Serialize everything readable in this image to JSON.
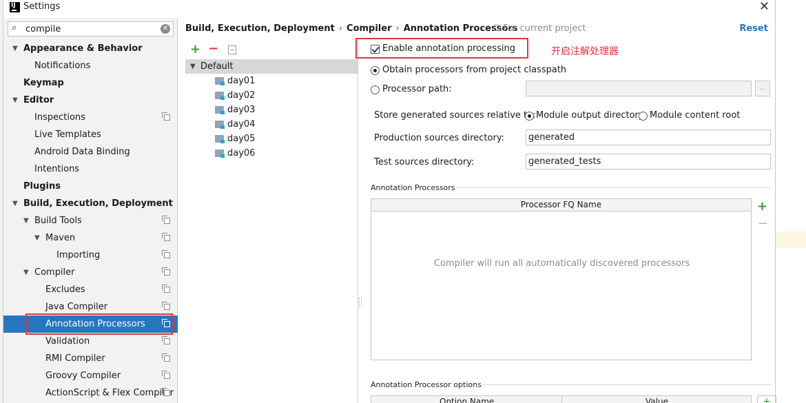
{
  "window": {
    "title": "Settings"
  },
  "search": {
    "value": "compile"
  },
  "sidebar": {
    "items": [
      {
        "label": "Appearance & Behavior",
        "level": 0,
        "arrow": "expanded",
        "bold": true
      },
      {
        "label": "Notifications",
        "level": 1,
        "arrow": "none"
      },
      {
        "label": "Keymap",
        "level": 0,
        "arrow": "none",
        "bold": true
      },
      {
        "label": "Editor",
        "level": 0,
        "arrow": "expanded",
        "bold": true
      },
      {
        "label": "Inspections",
        "level": 1,
        "arrow": "none",
        "copy": true
      },
      {
        "label": "Live Templates",
        "level": 1,
        "arrow": "none"
      },
      {
        "label": "Android Data Binding",
        "level": 1,
        "arrow": "none"
      },
      {
        "label": "Intentions",
        "level": 1,
        "arrow": "none"
      },
      {
        "label": "Plugins",
        "level": 0,
        "arrow": "none",
        "bold": true
      },
      {
        "label": "Build, Execution, Deployment",
        "level": 0,
        "arrow": "expanded",
        "bold": true
      },
      {
        "label": "Build Tools",
        "level": 1,
        "arrow": "expanded",
        "copy": true
      },
      {
        "label": "Maven",
        "level": 2,
        "arrow": "expanded",
        "copy": true
      },
      {
        "label": "Importing",
        "level": 3,
        "arrow": "none",
        "copy": true
      },
      {
        "label": "Compiler",
        "level": 1,
        "arrow": "expanded",
        "copy": true
      },
      {
        "label": "Excludes",
        "level": 2,
        "arrow": "none",
        "copy": true
      },
      {
        "label": "Java Compiler",
        "level": 2,
        "arrow": "none",
        "copy": true
      },
      {
        "label": "Annotation Processors",
        "level": 2,
        "arrow": "none",
        "copy": true,
        "selected": true
      },
      {
        "label": "Validation",
        "level": 2,
        "arrow": "none",
        "copy": true
      },
      {
        "label": "RMI Compiler",
        "level": 2,
        "arrow": "none",
        "copy": true
      },
      {
        "label": "Groovy Compiler",
        "level": 2,
        "arrow": "none",
        "copy": true
      },
      {
        "label": "ActionScript & Flex Compiler",
        "level": 2,
        "arrow": "none",
        "copy": true
      }
    ]
  },
  "breadcrumb": {
    "parts": [
      "Build, Execution, Deployment",
      "Compiler",
      "Annotation Processors"
    ],
    "separator": "›",
    "scope": "For current project"
  },
  "reset_label": "Reset",
  "profiles": {
    "default_label": "Default",
    "modules": [
      "day01",
      "day02",
      "day03",
      "day04",
      "day05",
      "day06"
    ]
  },
  "form": {
    "enable_label": "Enable annotation processing",
    "enable_checked": true,
    "annotation_note": "开启注解处理器",
    "obtain_label": "Obtain processors from project classpath",
    "path_label": "Processor path:",
    "path_value": "",
    "browse_label": "...",
    "store_label": "Store generated sources relative to:",
    "module_output_label": "Module output directory",
    "module_content_label": "Module content root",
    "prod_label": "Production sources directory:",
    "prod_value": "generated",
    "test_label": "Test sources directory:",
    "test_value": "generated_tests"
  },
  "processors": {
    "section_label": "Annotation Processors",
    "column": "Processor FQ Name",
    "empty_text": "Compiler will run all automatically discovered processors"
  },
  "options": {
    "section_label": "Annotation Processor options",
    "col_name": "Option Name",
    "col_value": "Value"
  },
  "colors": {
    "selection": "#2675bf",
    "highlight_box": "#e0353a",
    "link": "#2a6fc0",
    "add": "#3a9a3a",
    "remove": "#dd3333"
  }
}
